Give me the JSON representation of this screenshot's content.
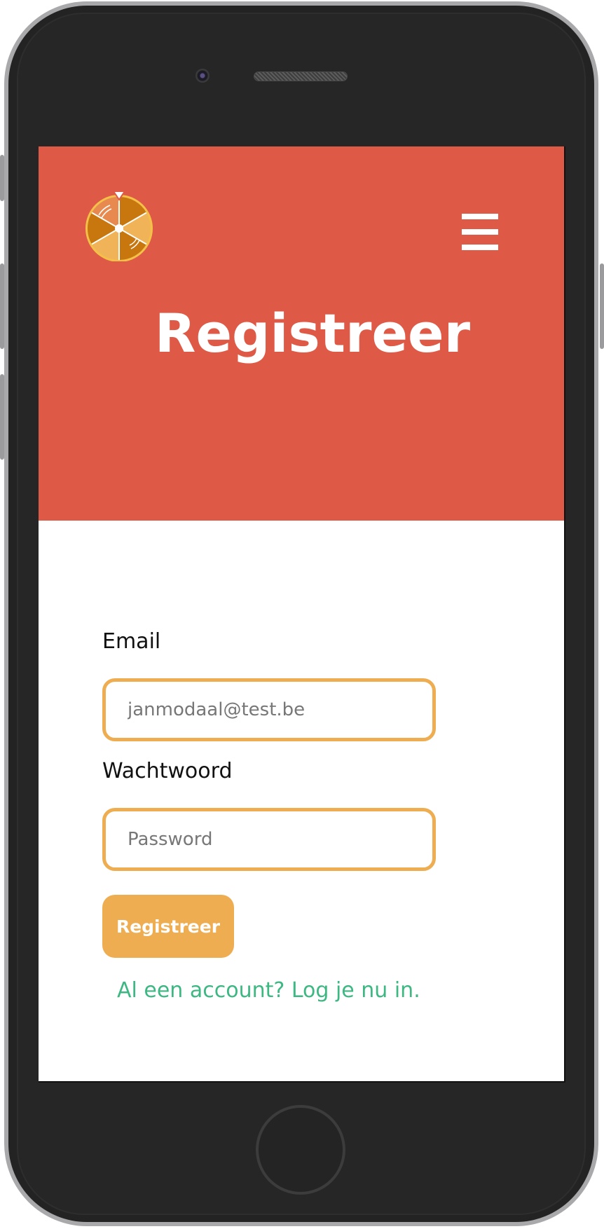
{
  "header": {
    "logo_icon": "prize-wheel-icon",
    "menu_icon": "hamburger-menu-icon",
    "title": "Registreer",
    "background_color": "#de5a47"
  },
  "form": {
    "email": {
      "label": "Email",
      "value": "janmodaal@test.be"
    },
    "password": {
      "label": "Wachtwoord",
      "placeholder": "Password"
    },
    "submit_label": "Registreer",
    "login_link": "Al een account? Log je nu in.",
    "accent_color": "#efad52",
    "link_color": "#3db883"
  }
}
